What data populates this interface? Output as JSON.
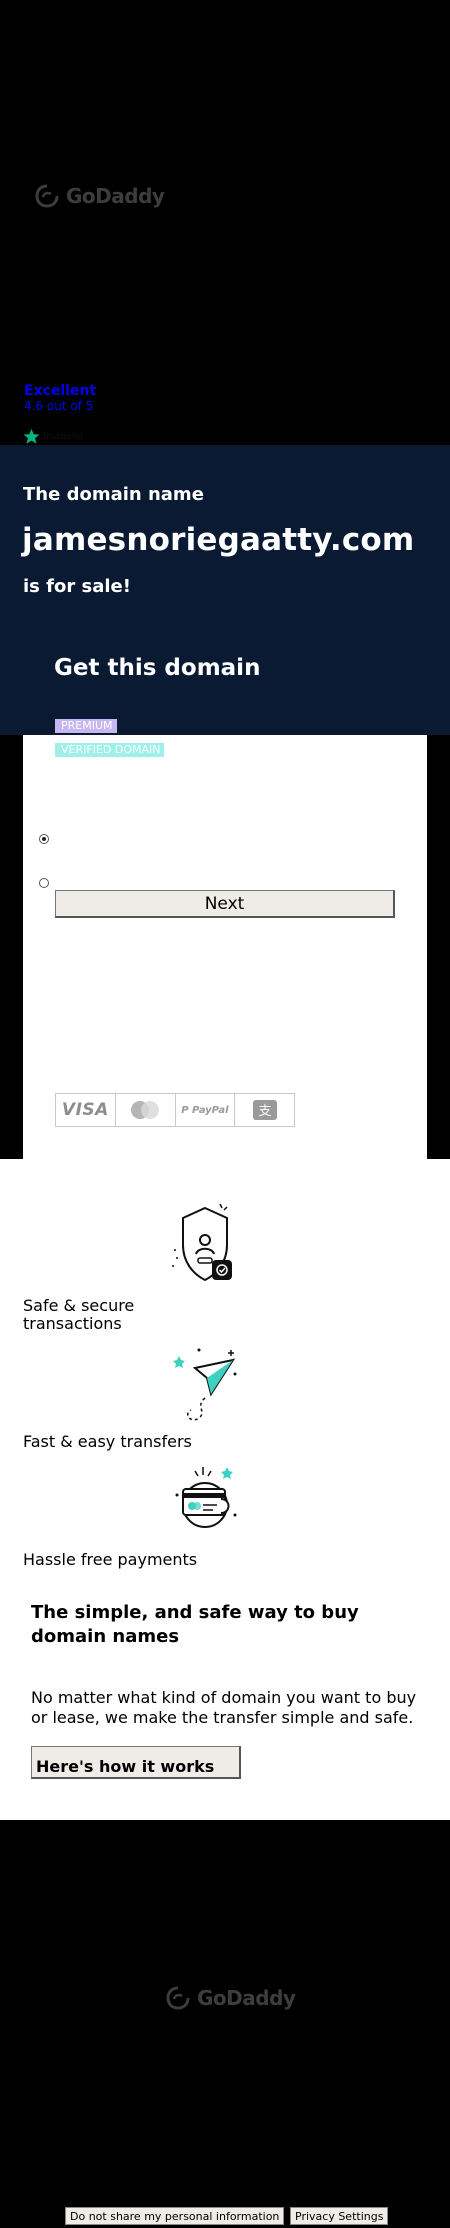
{
  "header": {
    "logo_text": "GoDaddy"
  },
  "trustpilot": {
    "rating_label": "Excellent",
    "score_text": "4.6 out of 5",
    "brand": "Trustpilot"
  },
  "hero": {
    "pre_text": "The domain name",
    "domain": "jamesnoriegaatty.com",
    "post_text": "is for sale!",
    "cta_title": "Get this domain"
  },
  "card": {
    "badges": {
      "premium": "PREMIUM",
      "verified": "VERIFIED DOMAIN"
    },
    "next_label": "Next",
    "payment_methods": [
      "VISA",
      "Mastercard",
      "PayPal",
      "Alipay"
    ]
  },
  "features": [
    {
      "label": "Safe & secure transactions",
      "icon": "shield-user-icon"
    },
    {
      "label": "Fast & easy transfers",
      "icon": "paper-plane-icon"
    },
    {
      "label": "Hassle free payments",
      "icon": "hand-card-icon"
    }
  ],
  "simple": {
    "title": "The simple, and safe way to buy domain names",
    "text": "No matter what kind of domain you want to buy or lease, we make the transfer simple and safe.",
    "button_label": "Here's how it works"
  },
  "footer": {
    "logo_text": "GoDaddy",
    "do_not_share_label": "Do not share my personal information",
    "privacy_settings_label": "Privacy Settings"
  },
  "colors": {
    "hero_bg": "#0b1a33",
    "premium_badge": "#c6b6f2",
    "verified_badge": "#9ff0ea",
    "trustpilot_green": "#00b67a"
  }
}
